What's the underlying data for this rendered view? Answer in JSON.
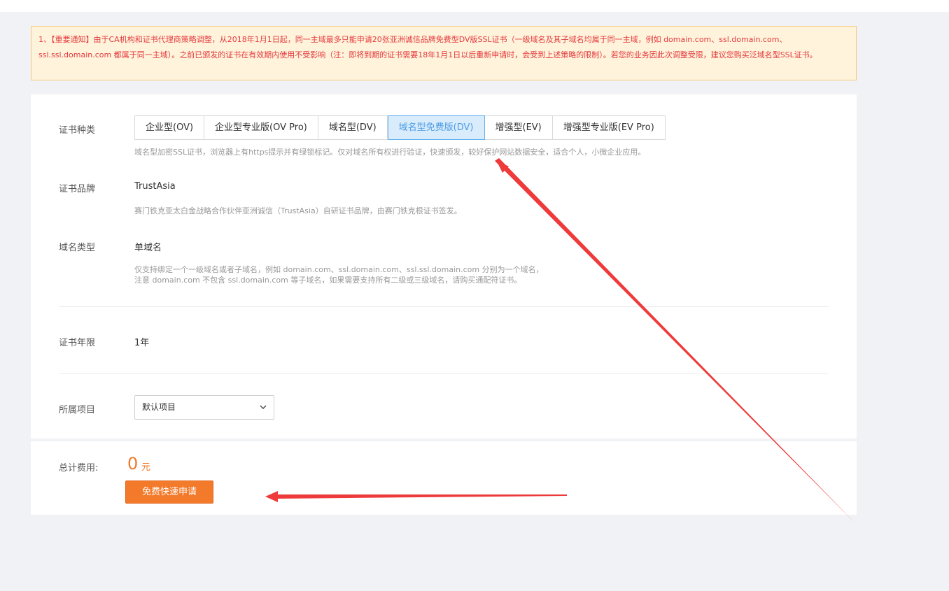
{
  "notice": {
    "text": "1、【重要通知】由于CA机构和证书代理商策略调整，从2018年1月1日起，同一主域最多只能申请20张亚洲诚信品牌免费型DV版SSL证书（一级域名及其子域名均属于同一主域，例如 domain.com、ssl.domain.com、ssl.ssl.domain.com 都属于同一主域）。之前已颁发的证书在有效期内使用不受影响（注：即将到期的证书需要18年1月1日以后重新申请时，会受到上述策略的限制）。若您的业务因此次调整受限，建议您购买泛域名型SSL证书。"
  },
  "cert_type": {
    "label": "证书种类",
    "tabs": [
      {
        "label": "企业型(OV)"
      },
      {
        "label": "企业型专业版(OV Pro)"
      },
      {
        "label": "域名型(DV)"
      },
      {
        "label": "域名型免费版(DV)"
      },
      {
        "label": "增强型(EV)"
      },
      {
        "label": "增强型专业版(EV Pro)"
      }
    ],
    "selected": "域名型免费版(DV)",
    "description": "域名型加密SSL证书，浏览器上有https提示并有绿锁标记。仅对域名所有权进行验证，快速颁发，较好保护网站数据安全，适合个人，小微企业应用。"
  },
  "brand": {
    "label": "证书品牌",
    "value": "TrustAsia",
    "description": "赛门铁克亚太白金战略合作伙伴亚洲诚信（TrustAsia）自研证书品牌，由赛门铁克根证书签发。"
  },
  "domain_type": {
    "label": "域名类型",
    "value": "单域名",
    "description_line1": "仅支持绑定一个一级域名或者子域名，例如 domain.com、ssl.domain.com、ssl.ssl.domain.com 分别为一个域名，",
    "description_line2": "注意 domain.com 不包含 ssl.domain.com 等子域名，如果需要支持所有二级或三级域名，请购买通配符证书。"
  },
  "duration": {
    "label": "证书年限",
    "value": "1年"
  },
  "project": {
    "label": "所属项目",
    "selected": "默认项目"
  },
  "total": {
    "label": "总计费用:",
    "amount": "0",
    "unit": "元"
  },
  "apply_button": {
    "label": "免费快速申请"
  },
  "colors": {
    "accent": "#f37a2a",
    "tab_active_bg": "#d9ecfb",
    "tab_active_text": "#4d9de6",
    "notice_text": "#e4393c",
    "annotation_arrow": "#ee3a3a"
  }
}
